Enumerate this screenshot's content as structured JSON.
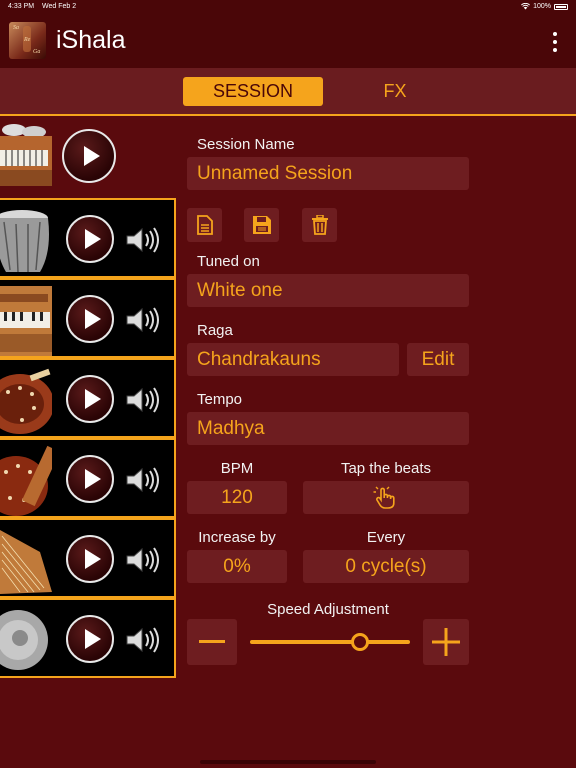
{
  "status": {
    "time": "4:33 PM",
    "date": "Wed Feb 2",
    "battery": "100%"
  },
  "app": {
    "title": "iShala",
    "logo_text": [
      "Sa",
      "Re",
      "Ga"
    ]
  },
  "tabs": [
    {
      "label": "SESSION",
      "active": true
    },
    {
      "label": "FX",
      "active": false
    }
  ],
  "instruments": [
    {
      "name": "harmonium-tabla",
      "has_volume": false
    },
    {
      "name": "tabla",
      "has_volume": true
    },
    {
      "name": "harmonium",
      "has_volume": true
    },
    {
      "name": "tanpura",
      "has_volume": true
    },
    {
      "name": "sitar",
      "has_volume": true
    },
    {
      "name": "swarmandal",
      "has_volume": true
    },
    {
      "name": "manjira",
      "has_volume": true
    }
  ],
  "session": {
    "name_label": "Session Name",
    "name_value": "Unnamed Session",
    "tuned_label": "Tuned  on",
    "tuned_value": "White one",
    "raga_label": "Raga",
    "raga_value": "Chandrakauns",
    "edit_label": "Edit",
    "tempo_label": "Tempo",
    "tempo_value": "Madhya",
    "bpm_label": "BPM",
    "bpm_value": "120",
    "tap_label": "Tap the beats",
    "increase_label": "Increase by",
    "increase_value": "0%",
    "every_label": "Every",
    "every_value": "0 cycle(s)",
    "speed_label": "Speed Adjustment",
    "speed_level": 0.69
  },
  "colors": {
    "accent": "#f5a41c",
    "background": "#5a0a0d",
    "field": "#6e1d20"
  }
}
